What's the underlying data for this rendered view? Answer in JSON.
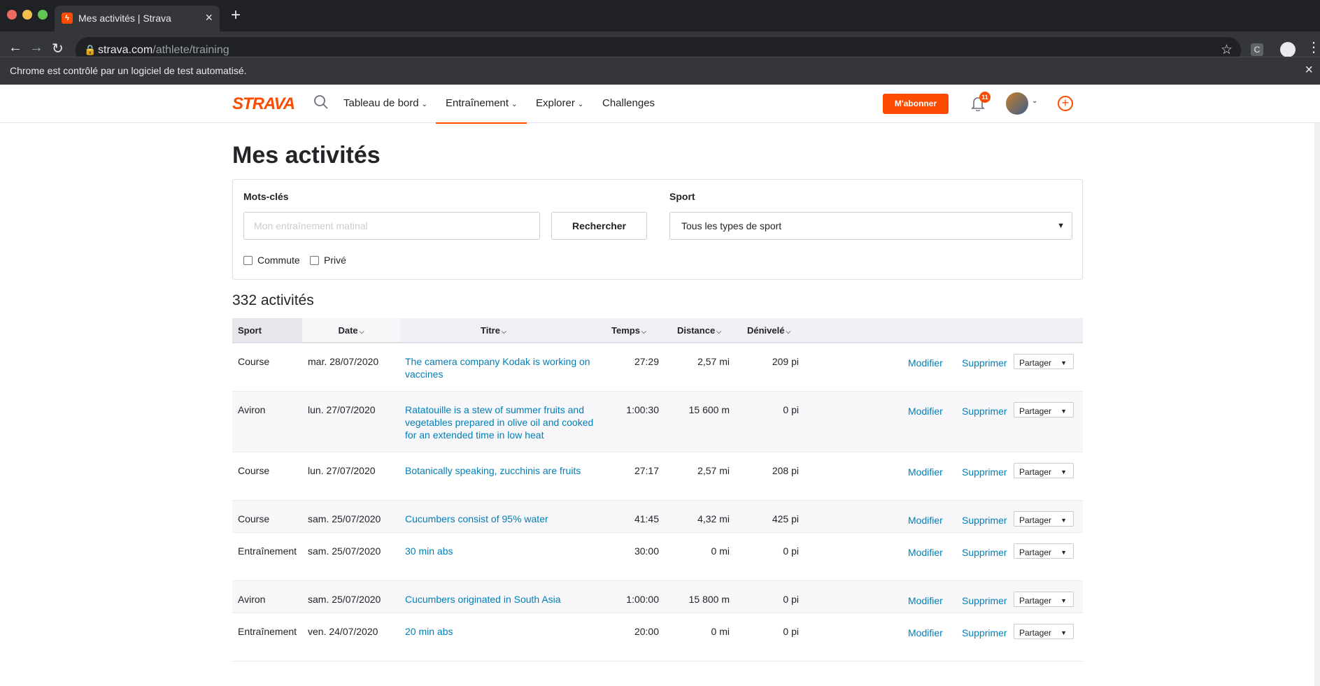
{
  "browser": {
    "tab_title": "Mes activités | Strava",
    "tab_favicon": "ϟ",
    "url_host": "strava.com",
    "url_path": "/athlete/training",
    "infobar_text": "Chrome est contrôlé par un logiciel de test automatisé.",
    "ext_letter": "C"
  },
  "header": {
    "logo": "STRAVA",
    "nav": [
      {
        "label": "Tableau de bord"
      },
      {
        "label": "Entraînement"
      },
      {
        "label": "Explorer"
      },
      {
        "label": "Challenges"
      }
    ],
    "subscribe_label": "M'abonner",
    "notifications_count": "11",
    "accent_color": "#fc4c02"
  },
  "page": {
    "title": "Mes activités",
    "filters": {
      "keywords_label": "Mots-clés",
      "keywords_placeholder": "Mon entraînement matinal",
      "search_label": "Rechercher",
      "sport_label": "Sport",
      "sport_selected": "Tous les types de sport",
      "commute_label": "Commute",
      "private_label": "Privé"
    },
    "count": "332 activités"
  },
  "table": {
    "headers": {
      "sport": "Sport",
      "date": "Date",
      "title": "Titre",
      "time": "Temps",
      "distance": "Distance",
      "elevation": "Dénivelé"
    },
    "rows": [
      {
        "sport": "Course",
        "date": "mar. 28/07/2020",
        "title": "The camera company Kodak is working on vaccines",
        "time": "27:29",
        "distance": "2,57 mi",
        "elevation": "209 pi",
        "edit": "Modifier",
        "delete": "Supprimer",
        "share": "Partager"
      },
      {
        "sport": "Aviron",
        "date": "lun. 27/07/2020",
        "title": "Ratatouille is a stew of summer fruits and vegetables prepared in olive oil and cooked for an extended time in low heat",
        "time": "1:00:30",
        "distance": "15 600 m",
        "elevation": "0 pi",
        "edit": "Modifier",
        "delete": "Supprimer",
        "share": "Partager"
      },
      {
        "sport": "Course",
        "date": "lun. 27/07/2020",
        "title": "Botanically speaking, zucchinis are fruits",
        "time": "27:17",
        "distance": "2,57 mi",
        "elevation": "208 pi",
        "edit": "Modifier",
        "delete": "Supprimer",
        "share": "Partager"
      },
      {
        "sport": "Course",
        "date": "sam. 25/07/2020",
        "title": "Cucumbers consist of 95% water",
        "time": "41:45",
        "distance": "4,32 mi",
        "elevation": "425 pi",
        "edit": "Modifier",
        "delete": "Supprimer",
        "share": "Partager"
      },
      {
        "sport": "Entraînement",
        "date": "sam. 25/07/2020",
        "title": "30 min abs",
        "time": "30:00",
        "distance": "0 mi",
        "elevation": "0 pi",
        "edit": "Modifier",
        "delete": "Supprimer",
        "share": "Partager"
      },
      {
        "sport": "Aviron",
        "date": "sam. 25/07/2020",
        "title": "Cucumbers originated in South Asia",
        "time": "1:00:00",
        "distance": "15 800 m",
        "elevation": "0 pi",
        "edit": "Modifier",
        "delete": "Supprimer",
        "share": "Partager"
      },
      {
        "sport": "Entraînement",
        "date": "ven. 24/07/2020",
        "title": "20 min abs",
        "time": "20:00",
        "distance": "0 mi",
        "elevation": "0 pi",
        "edit": "Modifier",
        "delete": "Supprimer",
        "share": "Partager"
      }
    ]
  }
}
